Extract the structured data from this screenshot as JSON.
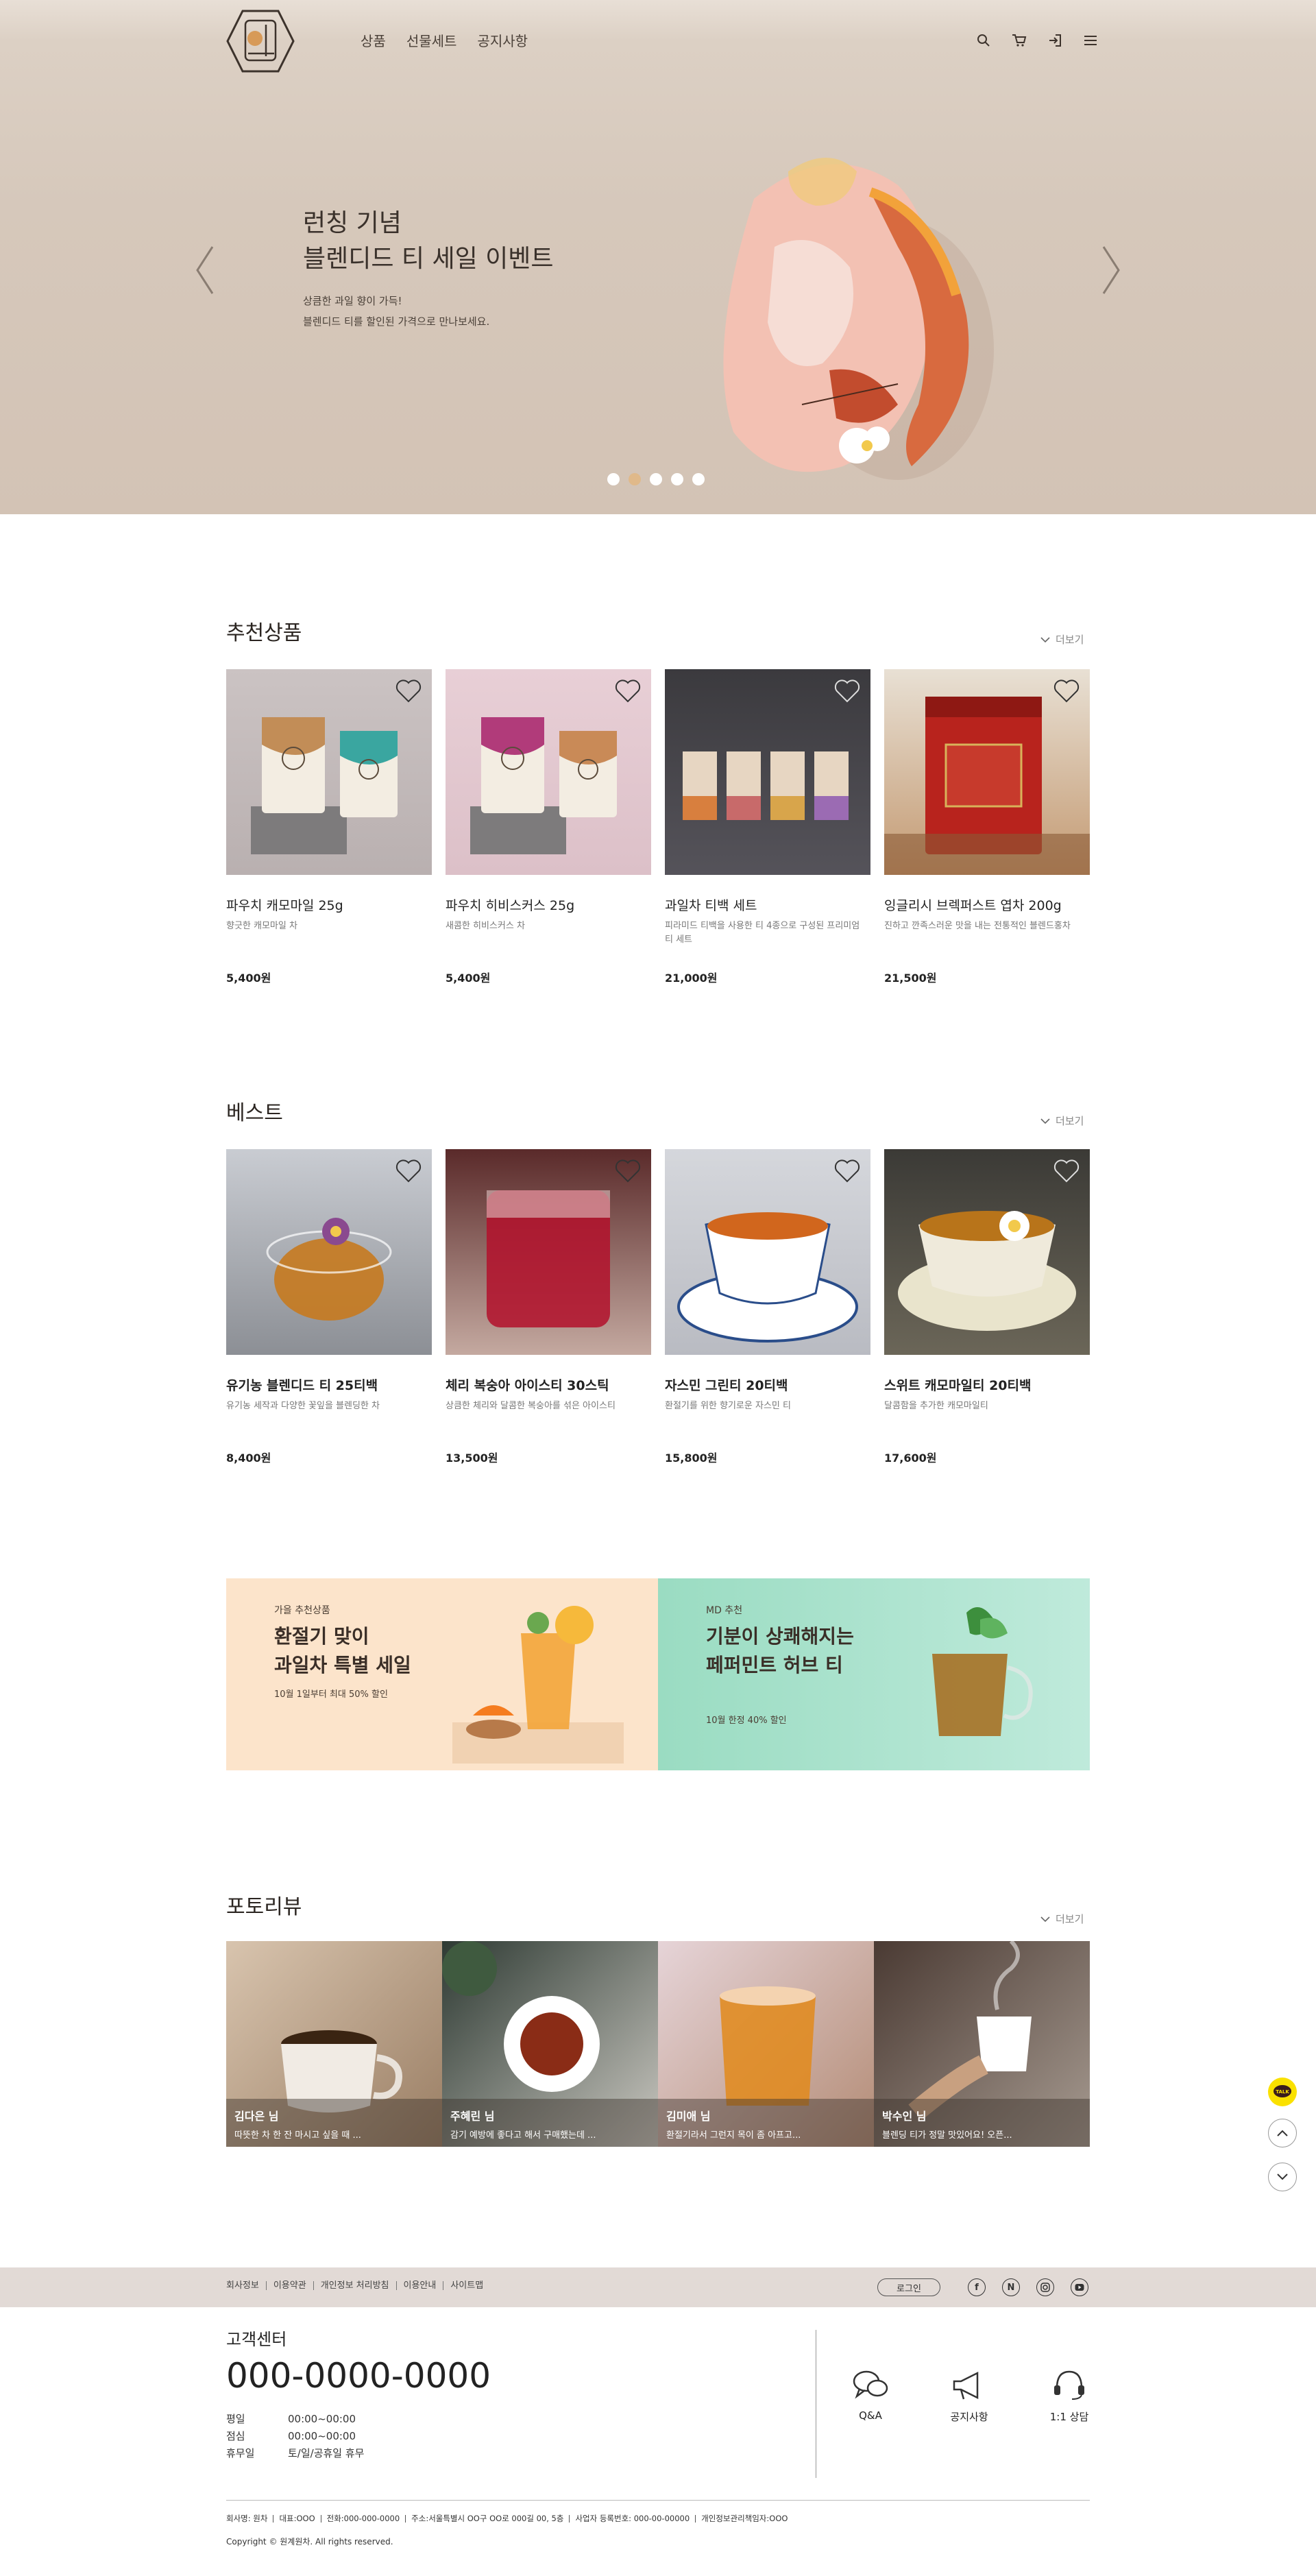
{
  "header": {
    "logo_alt": "차",
    "nav": [
      "상품",
      "선물세트",
      "공지사항"
    ],
    "icons": [
      "search-icon",
      "cart-icon",
      "login-icon",
      "menu-icon"
    ]
  },
  "hero": {
    "title_line1": "런칭 기념",
    "title_line2": "블렌디드 티 세일 이벤트",
    "desc_line1": "상큼한 과일 향이 가득!",
    "desc_line2": "블렌디드 티를 할인된 가격으로 만나보세요.",
    "slide_count": 5,
    "active_slide": 2
  },
  "recommend": {
    "title": "추천상품",
    "more": "더보기",
    "items": [
      {
        "name": "파우치 캐모마일 25g",
        "desc": "향긋한 캐모마일 차",
        "price": "5,400원"
      },
      {
        "name": "파우치 히비스커스 25g",
        "desc": "새콤한 히비스커스 차",
        "price": "5,400원"
      },
      {
        "name": "과일차 티백 세트",
        "desc": "피라미드 티백을 사용한 티 4종으로 구성된 프리미엄 티 세트",
        "price": "21,000원"
      },
      {
        "name": "잉글리시 브렉퍼스트 엽차 200g",
        "desc": "진하고 깐족스러운 맛을 내는 전통적인 블렌드홍차",
        "price": "21,500원"
      }
    ]
  },
  "best": {
    "title": "베스트",
    "more": "더보기",
    "items": [
      {
        "name": "유기농 블렌디드 티 25티백",
        "desc": "유기농 세작과 다양한 꽃잎을 블렌딩한 차",
        "price": "8,400원"
      },
      {
        "name": "체리 복숭아 아이스티 30스틱",
        "desc": "상큼한 체리와 달콤한 복숭아를 섞은 아이스티",
        "price": "13,500원"
      },
      {
        "name": "자스민 그린티 20티백",
        "desc": "환절기를 위한 향기로운 자스민 티",
        "price": "15,800원"
      },
      {
        "name": "스위트 캐모마일티 20티백",
        "desc": "달콤함을 추가한 캐모마일티",
        "price": "17,600원"
      }
    ]
  },
  "banners": [
    {
      "small": "가을 추천상품",
      "title_line1": "환절기 맞이",
      "title_line2": "과일차 특별 세일",
      "sub": "10월 1일부터 최대 50% 할인"
    },
    {
      "small": "MD 추천",
      "title_line1": "기분이 상쾌해지는",
      "title_line2": "페퍼민트 허브 티",
      "sub": "10월 한정 40% 할인"
    }
  ],
  "reviews": {
    "title": "포토리뷰",
    "more": "더보기",
    "items": [
      {
        "name": "김다은 님",
        "text": "따뜻한 차 한 잔 마시고 싶을 때 ..."
      },
      {
        "name": "주혜린 님",
        "text": "감기 예방에 좋다고 해서 구매했는데 ..."
      },
      {
        "name": "김미애 님",
        "text": "환절기라서 그런지 목이 좀 아프고..."
      },
      {
        "name": "박수인 님",
        "text": "블렌딩 티가 정말 맛있어요! 오픈..."
      }
    ]
  },
  "float": {
    "talk": "TALK"
  },
  "footer": {
    "links": [
      "회사정보",
      "이용약관",
      "개인정보 처리방침",
      "이용안내",
      "사이트맵"
    ],
    "login": "로그인",
    "sns": [
      "f",
      "N",
      "instagram-icon",
      "youtube-icon"
    ],
    "cs_title": "고객센터",
    "phone": "000-0000-0000",
    "hours": [
      {
        "k": "평일",
        "v": "00:00~00:00"
      },
      {
        "k": "점심",
        "v": "00:00~00:00"
      },
      {
        "k": "휴무일",
        "v": "토/일/공휴일 휴무"
      }
    ],
    "quick": [
      "Q&A",
      "공지사항",
      "1:1 상담"
    ],
    "company": [
      "회사명: 원차",
      "대표:OOO",
      "전화:000-000-0000",
      "주소:서울특별시 OO구 OO로 000길 00, 5층",
      "사업자 등록번호: 000-00-00000",
      "개인정보관리책임자:OOO"
    ],
    "copyright": "Copyright © 원계원차. All rights reserved."
  },
  "colors": {
    "hero_bg": "#d6c8bb",
    "dot_active": "#e0b98a",
    "banner_left": "#fce4cb",
    "banner_right": "#aee3cf",
    "footer_bar": "#e2dad6",
    "talk": "#fae100"
  }
}
